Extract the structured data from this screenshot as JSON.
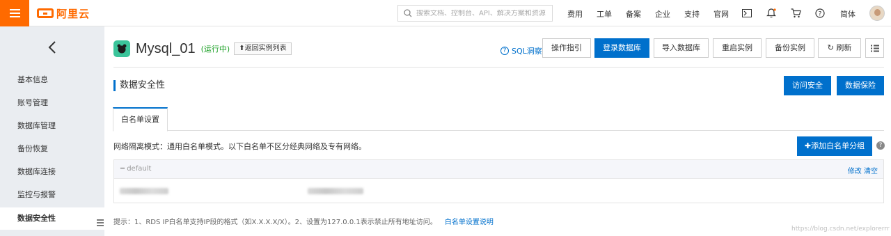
{
  "topbar": {
    "logo_text": "阿里云",
    "search_placeholder": "搜索文档、控制台、API、解决方案和资源",
    "nav": [
      "费用",
      "工单",
      "备案",
      "企业",
      "支持",
      "官网"
    ],
    "lang": "简体"
  },
  "sidebar": {
    "items": [
      "基本信息",
      "账号管理",
      "数据库管理",
      "备份恢复",
      "数据库连接",
      "监控与报警",
      "数据安全性"
    ],
    "active_index": 6
  },
  "header": {
    "title": "Mysql_01",
    "status": "(运行中)",
    "back_label": "返回实例列表",
    "sql_insight": "SQL洞察",
    "buttons": [
      "操作指引",
      "登录数据库",
      "导入数据库",
      "重启实例",
      "备份实例",
      "刷新"
    ]
  },
  "section": {
    "title": "数据安全性",
    "btn_access": "访问安全",
    "btn_protect": "数据保险"
  },
  "tabs": [
    "白名单设置"
  ],
  "whitelist": {
    "network_desc": "网络隔离模式：通用白名单模式。以下白名单不区分经典网络及专有网络。",
    "add_label": "添加白名单分组",
    "group_name": "default",
    "action_edit": "修改",
    "action_clear": "清空"
  },
  "tip": {
    "text": "提示：1、RDS IP白名单支持IP段的格式（如X.X.X.X/X）。2、设置为127.0.0.1表示禁止所有地址访问。",
    "link": "白名单设置说明"
  },
  "watermark": "https://blog.csdn.net/explorerrr",
  "colors": {
    "brand_orange": "#ff6a00",
    "primary_blue": "#0070cc",
    "status_green": "#1da027"
  }
}
